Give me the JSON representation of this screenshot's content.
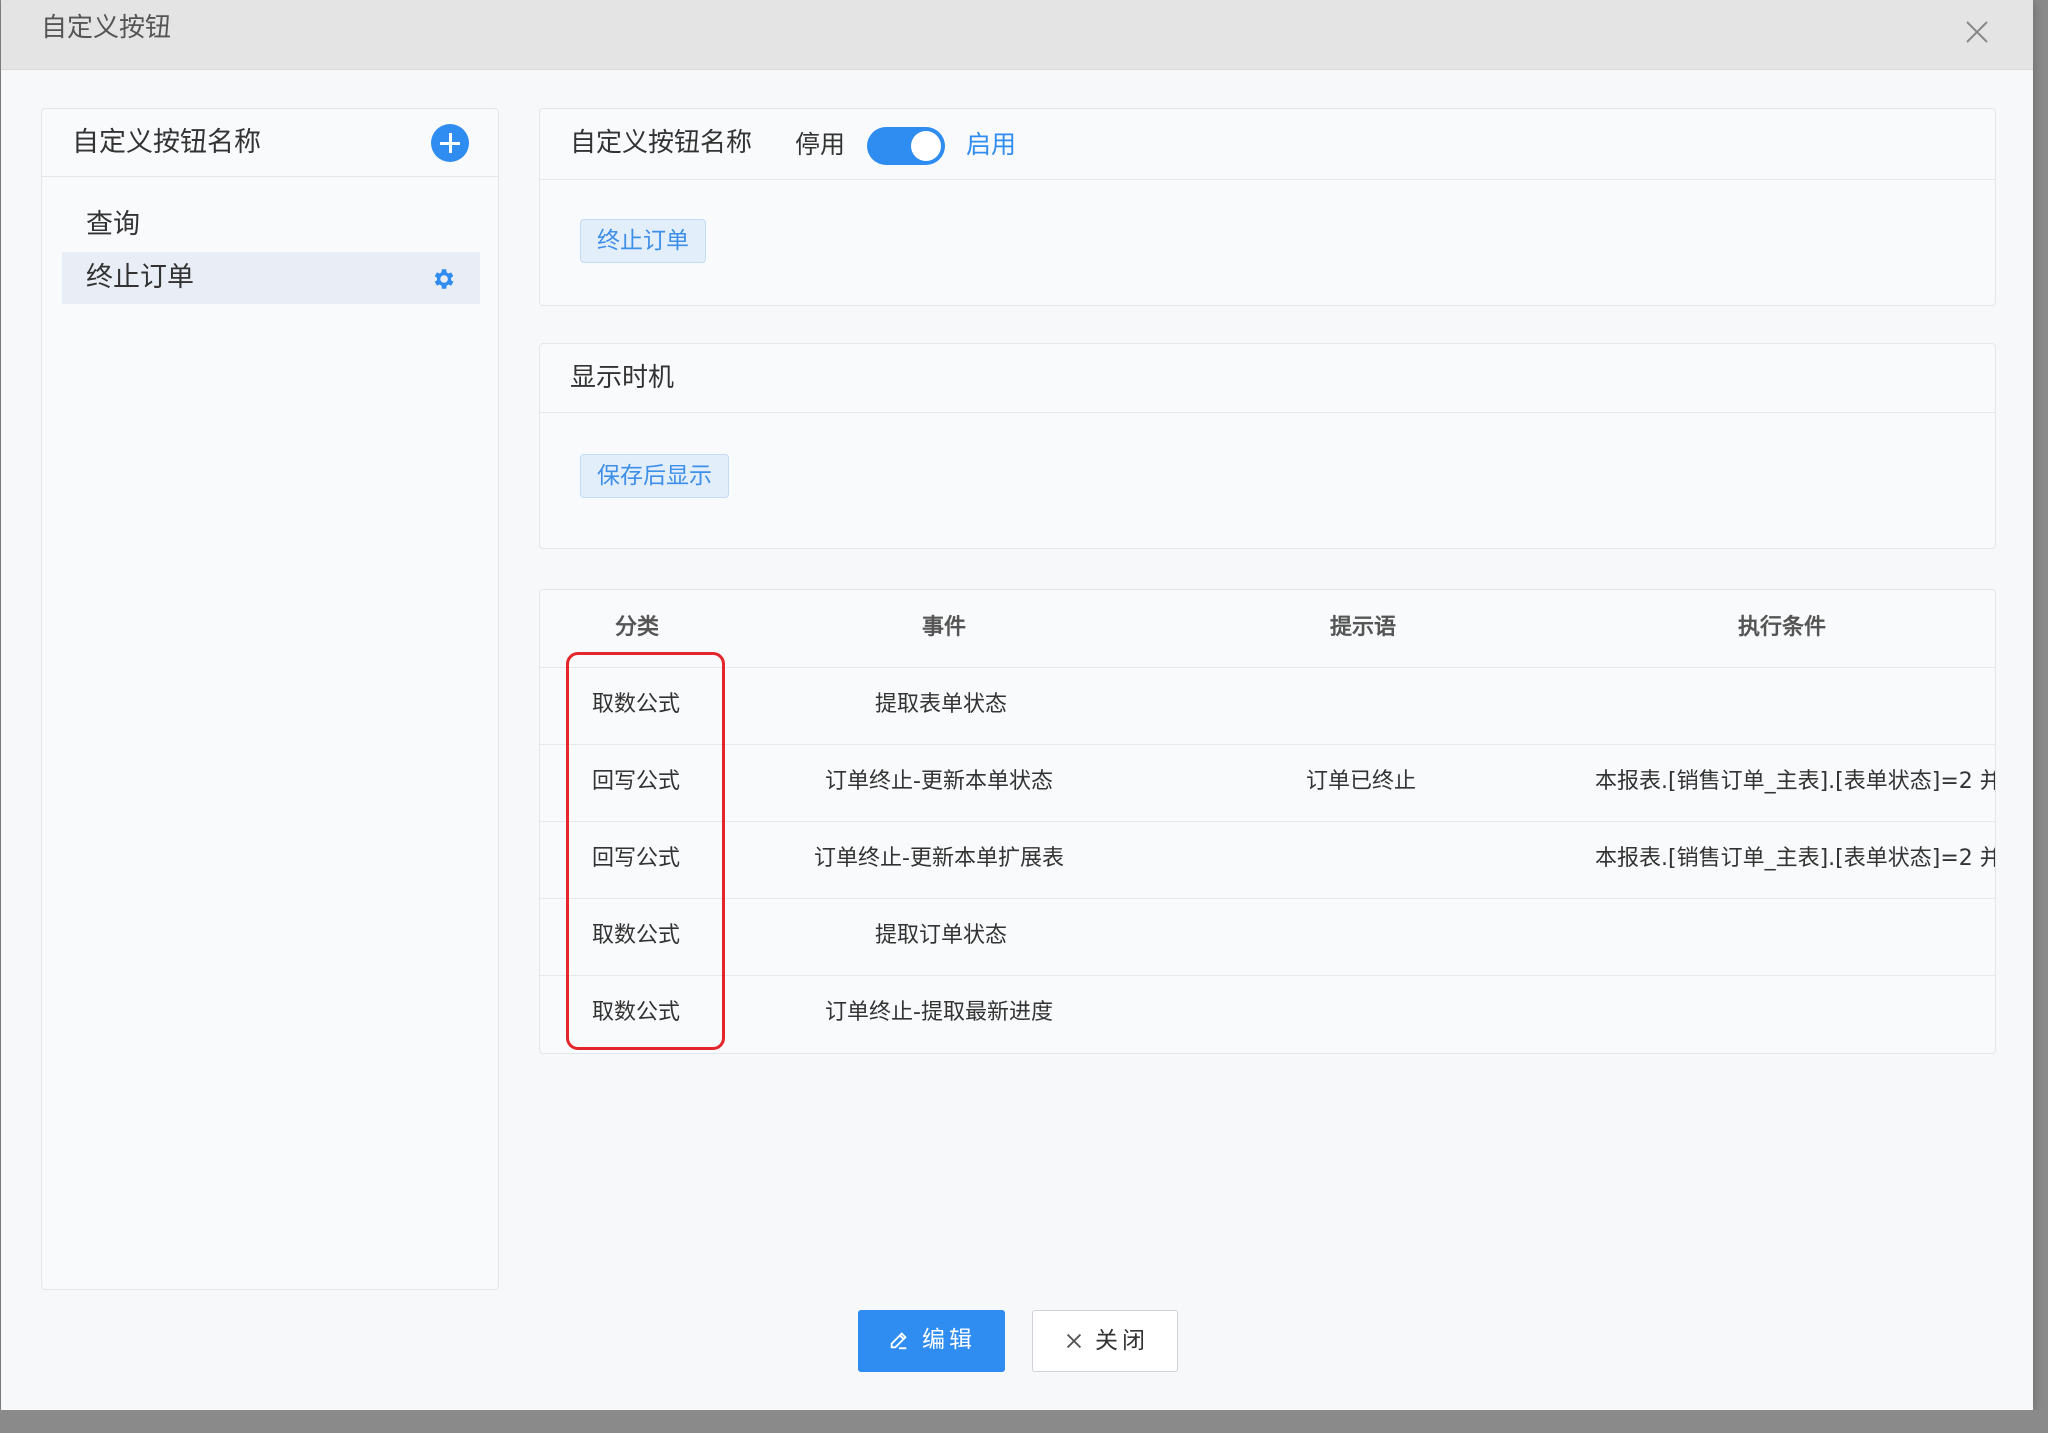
{
  "window": {
    "title": "自定义按钮"
  },
  "left_panel": {
    "header": "自定义按钮名称",
    "items": [
      {
        "label": "查询"
      },
      {
        "label": "终止订单"
      }
    ]
  },
  "name_card": {
    "title": "自定义按钮名称",
    "switch_off_label": "停用",
    "switch_on_label": "启用",
    "switch_enabled": true,
    "tag": "终止订单"
  },
  "timing_card": {
    "title": "显示时机",
    "tag": "保存后显示"
  },
  "table": {
    "headers": [
      "分类",
      "事件",
      "提示语",
      "执行条件"
    ],
    "rows": [
      {
        "category": "取数公式",
        "event": "提取表单状态",
        "prompt": "",
        "condition": ""
      },
      {
        "category": "回写公式",
        "event": "订单终止-更新本单状态",
        "prompt": "订单已终止",
        "condition": "本报表.[销售订单_主表].[表单状态]=2 并"
      },
      {
        "category": "回写公式",
        "event": "订单终止-更新本单扩展表",
        "prompt": "",
        "condition": "本报表.[销售订单_主表].[表单状态]=2 并"
      },
      {
        "category": "取数公式",
        "event": "提取订单状态",
        "prompt": "",
        "condition": ""
      },
      {
        "category": "取数公式",
        "event": "订单终止-提取最新进度",
        "prompt": "",
        "condition": ""
      }
    ]
  },
  "footer": {
    "edit_label": "编辑",
    "close_label": "关闭"
  },
  "colors": {
    "accent": "#2f8cf0",
    "highlight_box": "#e3262b"
  }
}
